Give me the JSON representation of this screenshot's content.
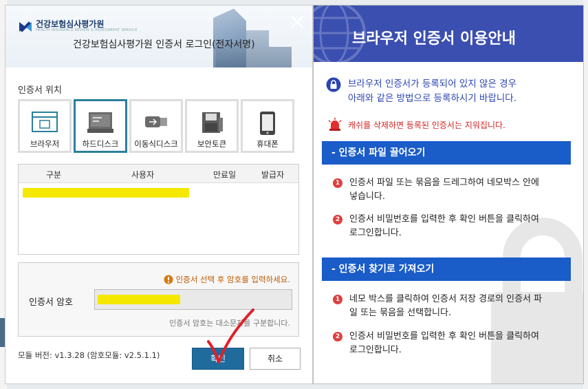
{
  "dialog": {
    "logo_name": "건강보험심사평가원",
    "logo_sub": "HEALTH INSURANCE REVIEW & ASSESSMENT SERVICE",
    "title": "건강보험심사평가원 인증서 로그인(전자서명)",
    "location_label": "인증서 위치",
    "locations": [
      {
        "label": "브라우저",
        "icon": "browser-icon",
        "selected": false
      },
      {
        "label": "하드디스크",
        "icon": "harddisk-icon",
        "selected": true
      },
      {
        "label": "이동식디스크",
        "icon": "usb-icon",
        "selected": false
      },
      {
        "label": "보안토큰",
        "icon": "security-token-icon",
        "selected": false
      },
      {
        "label": "휴대폰",
        "icon": "mobile-phone-icon",
        "selected": false
      }
    ],
    "table": {
      "headers": [
        "구분",
        "사용자",
        "만료일",
        "발급자"
      ]
    },
    "password": {
      "notice": "인증서 선택 후 암호를 입력하세요.",
      "label": "인증서 암호",
      "hint": "인증서 암호는 대소문자를 구분합니다."
    },
    "module_version": "모듈 버전: v1.3.28 (암호모듈: v2.5.1.1)",
    "ok_label": "확인",
    "cancel_label": "취소"
  },
  "guide": {
    "title": "브라우저 인증서 이용안내",
    "info_lines": [
      "브라우저 인증서가 등록되어 있지 않은 경우",
      "아래와 같은 방법으로 등록하시기 바랍니다."
    ],
    "warning": "캐쉬를 삭제하면 등록된 인증서는 지워집니다.",
    "sections": [
      {
        "title": "- 인증서 파일 끌어오기",
        "steps": [
          {
            "num": "1",
            "text": "인증서 파일 또는 묶음을 드레그하여 네모박스 안에 넣습니다."
          },
          {
            "num": "2",
            "text": "인증서 비밀번호를 입력한 후 확인 버튼을 클릭하여 로그인합니다."
          }
        ]
      },
      {
        "title": "- 인증서 찾기로 가져오기",
        "steps": [
          {
            "num": "1",
            "text": "네모 박스를 클릭하여 인증서 저장 경로의 인증서 파일 또는 묶음을 선택합니다."
          },
          {
            "num": "2",
            "text": "인증서 비밀번호를 입력한 후 확인 버튼을 클릭하여 로그인합니다."
          }
        ]
      }
    ]
  },
  "colors": {
    "selected_border": "#2a7f9a",
    "ok_button": "#1f6b9c",
    "guide_header": "#3b4fb0",
    "section_bar": "#1a5cc8",
    "info_text": "#2b45b0",
    "warning_text": "#d32222",
    "highlight": "#f5e800",
    "checkmark": "#e0202a"
  }
}
